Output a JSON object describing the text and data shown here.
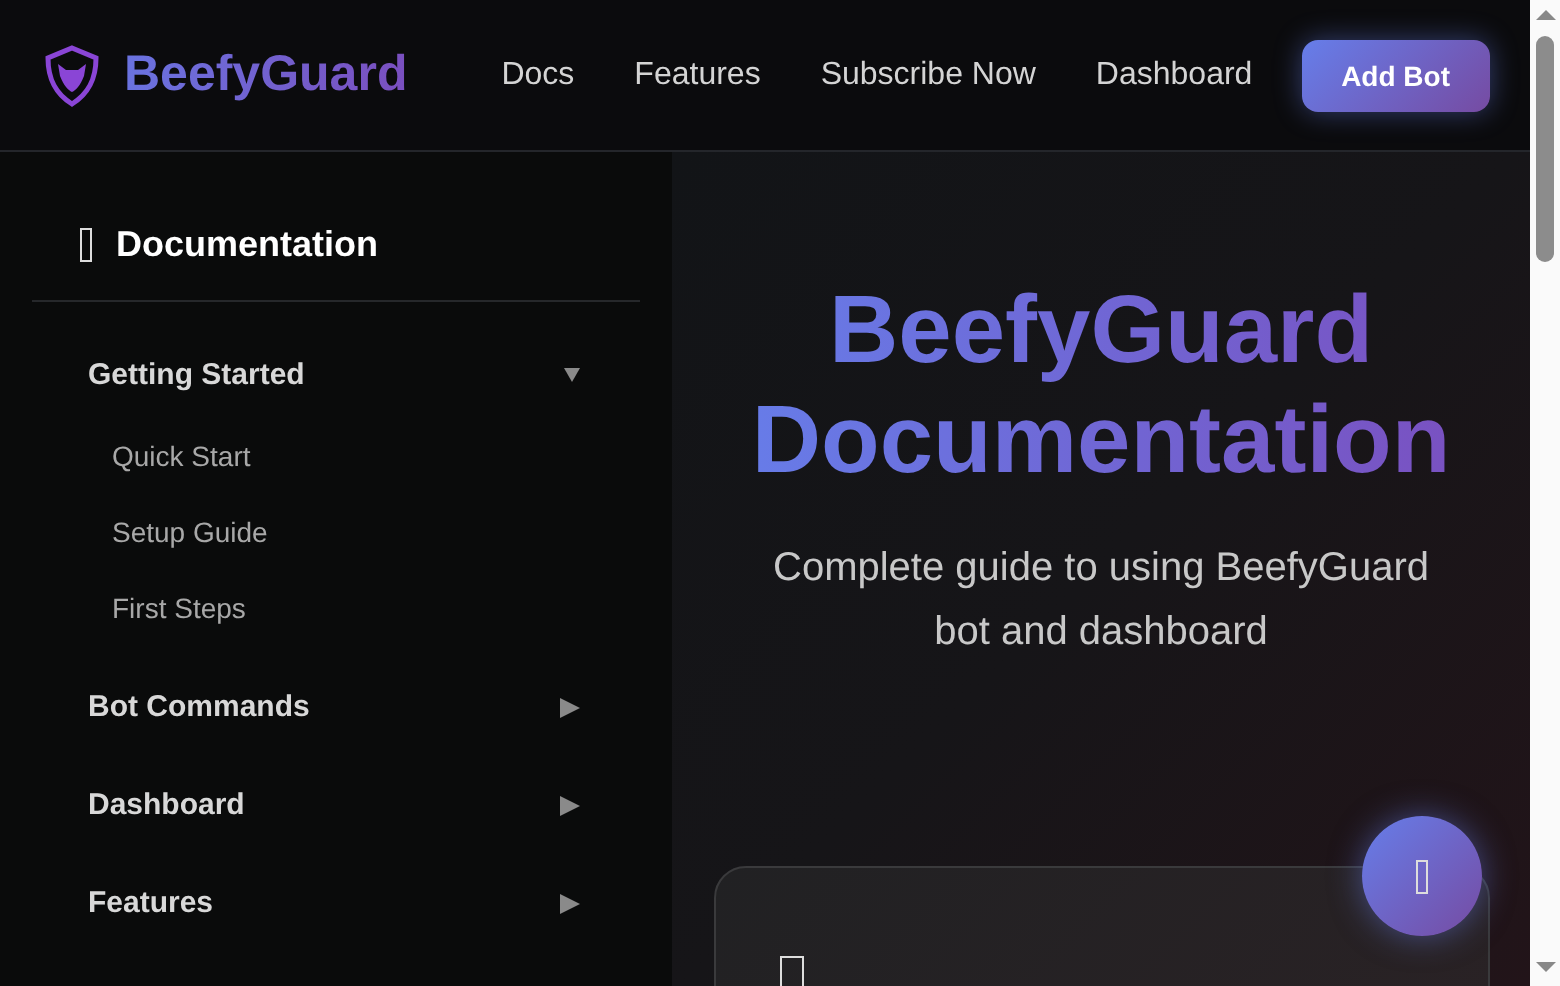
{
  "header": {
    "brand": "BeefyGuard",
    "nav": [
      {
        "label": "Docs"
      },
      {
        "label": "Features"
      },
      {
        "label": "Subscribe Now"
      },
      {
        "label": "Dashboard"
      }
    ],
    "cta": "Add Bot"
  },
  "sidebar": {
    "title": "Documentation",
    "sections": [
      {
        "label": "Getting Started",
        "expanded": true,
        "children": [
          {
            "label": "Quick Start"
          },
          {
            "label": "Setup Guide"
          },
          {
            "label": "First Steps"
          }
        ]
      },
      {
        "label": "Bot Commands",
        "expanded": false
      },
      {
        "label": "Dashboard",
        "expanded": false
      },
      {
        "label": "Features",
        "expanded": false
      }
    ]
  },
  "hero": {
    "title": "BeefyGuard Documentation",
    "subtitle": "Complete guide to using BeefyGuard bot and dashboard"
  }
}
